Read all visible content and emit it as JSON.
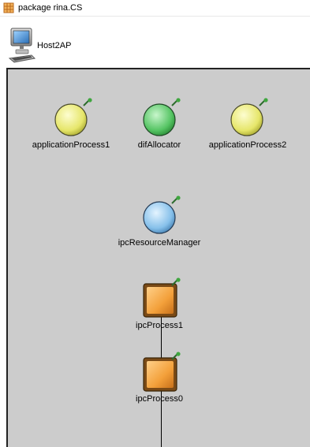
{
  "package": {
    "icon": "package-icon",
    "label": "package rina.CS"
  },
  "host": {
    "icon": "computer-icon",
    "label": "Host2AP"
  },
  "modules": {
    "applicationProcess1": {
      "label": "applicationProcess1",
      "icon": "yellow-sphere-icon",
      "color": "#ecec7c"
    },
    "difAllocator": {
      "label": "difAllocator",
      "icon": "green-sphere-icon",
      "color": "#6fd27a"
    },
    "applicationProcess2": {
      "label": "applicationProcess2",
      "icon": "yellow-sphere-icon",
      "color": "#ecec7c"
    },
    "ipcResourceManager": {
      "label": "ipcResourceManager",
      "icon": "blue-sphere-icon",
      "color": "#8cc4ec"
    },
    "ipcProcess1": {
      "label": "ipcProcess1",
      "icon": "orange-box-icon",
      "color": "#f0a23c"
    },
    "ipcProcess0": {
      "label": "ipcProcess0",
      "icon": "orange-box-icon",
      "color": "#f0a23c"
    }
  },
  "colors": {
    "canvas": "#cccccc",
    "pin": "#3c8c3c"
  }
}
